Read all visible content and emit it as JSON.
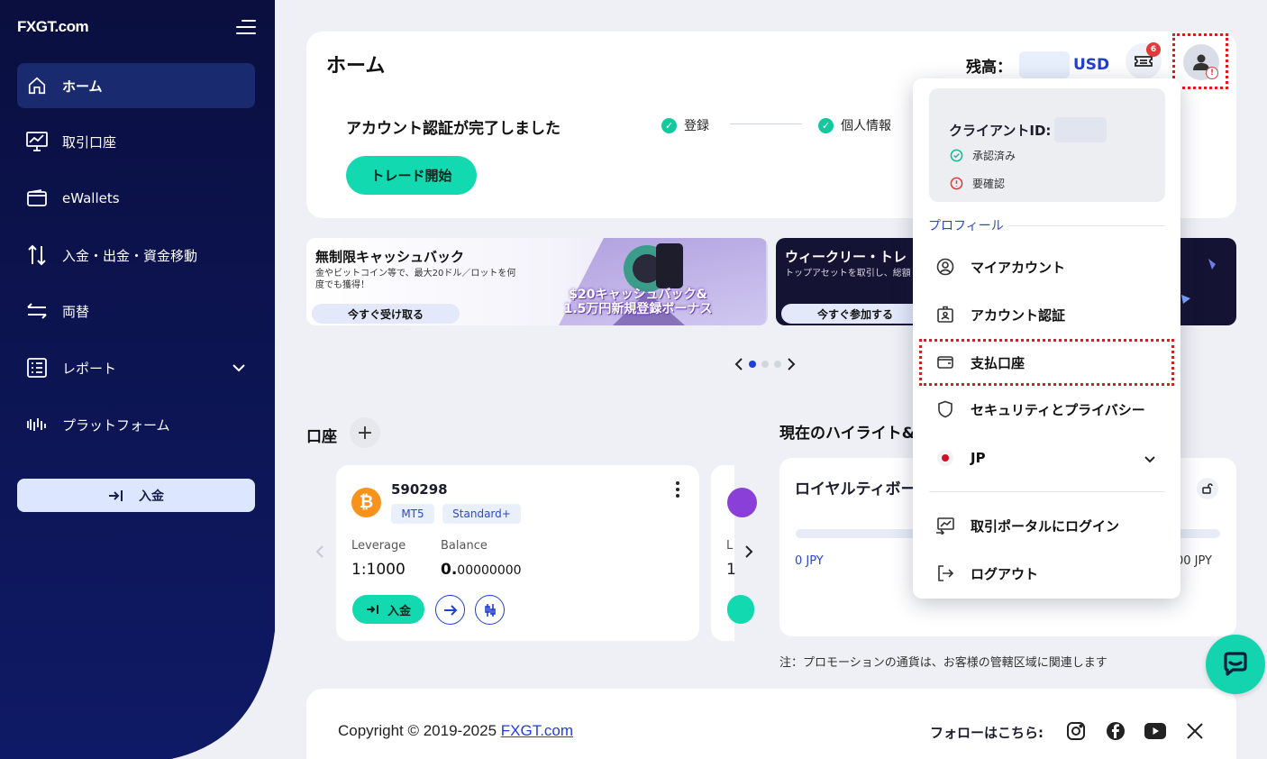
{
  "brand": {
    "logo": "FXGT.com"
  },
  "sidebar": {
    "items": [
      {
        "label": "ホーム",
        "icon": "home-icon",
        "active": true
      },
      {
        "label": "取引口座",
        "icon": "chart-monitor-icon"
      },
      {
        "label": "eWallets",
        "icon": "wallet-icon"
      },
      {
        "label": "入金・出金・資金移動",
        "icon": "transfer-arrows-icon"
      },
      {
        "label": "両替",
        "icon": "exchange-icon"
      },
      {
        "label": "レポート",
        "icon": "report-icon",
        "expandable": true
      },
      {
        "label": "プラットフォーム",
        "icon": "platform-icon"
      }
    ],
    "deposit_button": "入金"
  },
  "header": {
    "title": "ホーム",
    "balance_label": "残高：",
    "currency": "USD",
    "notification_count": "6"
  },
  "verification": {
    "title": "アカウント認証が完了しました",
    "trade_button": "トレード開始",
    "steps": [
      "登録",
      "個人情報"
    ]
  },
  "banners": [
    {
      "title": "無制限キャッシュバック",
      "subtitle": "金やビットコイン等で、最大20ドル／ロットを何度でも獲得！",
      "button": "今すぐ受け取る",
      "promo_line1": "$20キャッシュバック&",
      "promo_line2": "1.5万円新規登録ボーナス"
    },
    {
      "title": "ウィークリー・トレ",
      "subtitle": "トップアセットを取引し、総額",
      "button": "今すぐ参加する"
    }
  ],
  "carousel": {
    "slides": 3,
    "active": 1
  },
  "accounts": {
    "title": "口座",
    "card": {
      "number": "590298",
      "platform": "MT5",
      "type": "Standard+",
      "leverage_label": "Leverage",
      "leverage": "1:1000",
      "balance_label": "Balance",
      "balance_int": "0.",
      "balance_dec": "00000000",
      "deposit_button": "入金"
    }
  },
  "highlights": {
    "title": "現在のハイライト&",
    "card_title": "ロイヤルティボー",
    "min_label": "0 JPY",
    "max_label": "00 JPY",
    "note": "注：プロモーションの通貨は、お客様の管轄区域に関連します"
  },
  "footer": {
    "copyright_prefix": "Copyright © 2019-2025 ",
    "copyright_link": "FXGT.com",
    "follow_label": "フォローはこちら:",
    "social": [
      "instagram-icon",
      "facebook-icon",
      "youtube-icon",
      "x-icon"
    ]
  },
  "profile_menu": {
    "client_id_label": "クライアントID:",
    "status_approved": "承認済み",
    "status_required": "要確認",
    "profile_section": "プロフィール",
    "items": [
      {
        "label": "マイアカウント",
        "icon": "user-circle-icon"
      },
      {
        "label": "アカウント認証",
        "icon": "id-card-icon"
      },
      {
        "label": "支払口座",
        "icon": "wallet-icon",
        "highlighted": true
      },
      {
        "label": "セキュリティとプライバシー",
        "icon": "shield-icon"
      },
      {
        "label": "JP",
        "icon": "japan-flag-icon"
      },
      {
        "label": "取引ポータルにログイン",
        "icon": "portal-login-icon"
      },
      {
        "label": "ログアウト",
        "icon": "logout-icon"
      }
    ]
  },
  "colors": {
    "sidebar": "#0b1450",
    "accent": "#12d9b0",
    "link": "#1f3fd6",
    "alert": "#e01b1b"
  }
}
